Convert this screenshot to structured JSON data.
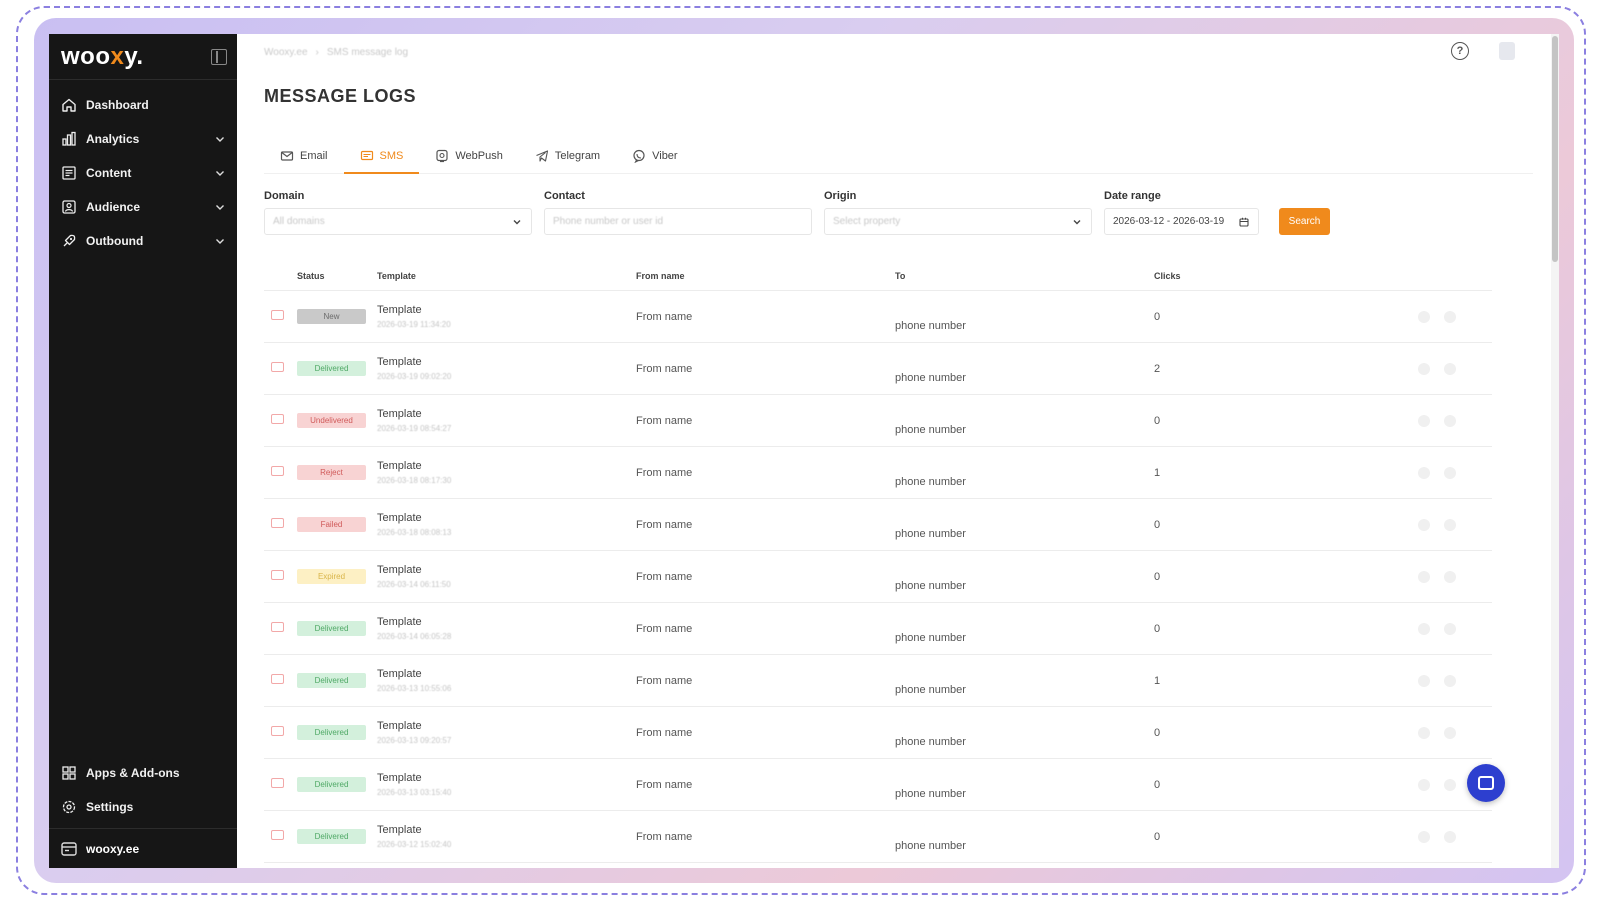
{
  "sidebar": {
    "logo_pre": "woo",
    "logo_x": "x",
    "logo_post": "y.",
    "nav": [
      {
        "label": "Dashboard",
        "icon": "home-icon",
        "expandable": false
      },
      {
        "label": "Analytics",
        "icon": "bar-chart-icon",
        "expandable": true
      },
      {
        "label": "Content",
        "icon": "content-icon",
        "expandable": true
      },
      {
        "label": "Audience",
        "icon": "user-icon",
        "expandable": true
      },
      {
        "label": "Outbound",
        "icon": "rocket-icon",
        "expandable": true
      }
    ],
    "bottom": [
      {
        "label": "Apps & Add-ons",
        "icon": "grid-icon"
      },
      {
        "label": "Settings",
        "icon": "gear-icon"
      }
    ],
    "footer": {
      "label": "wooxy.ee",
      "icon": "site-icon"
    }
  },
  "breadcrumb": [
    "Wooxy.ee",
    "SMS message log"
  ],
  "page": {
    "title": "MESSAGE LOGS"
  },
  "tabs": [
    {
      "label": "Email",
      "icon": "mail-icon",
      "active": false
    },
    {
      "label": "SMS",
      "icon": "sms-icon",
      "active": true
    },
    {
      "label": "WebPush",
      "icon": "webpush-icon",
      "active": false
    },
    {
      "label": "Telegram",
      "icon": "telegram-icon",
      "active": false
    },
    {
      "label": "Viber",
      "icon": "viber-icon",
      "active": false
    }
  ],
  "filters": {
    "domain": {
      "label": "Domain",
      "placeholder": "All domains"
    },
    "contact": {
      "label": "Contact",
      "placeholder": "Phone number or user id"
    },
    "origin": {
      "label": "Origin",
      "placeholder": "Select property"
    },
    "date_range": {
      "label": "Date range",
      "value": "2026-03-12 - 2026-03-19"
    },
    "search_label": "Search"
  },
  "table": {
    "headers": {
      "status": "Status",
      "template": "Template",
      "from": "From name",
      "to": "To",
      "clicks": "Clicks"
    },
    "rows": [
      {
        "status": "New",
        "status_class": "st-new",
        "template": "Template",
        "date": "2026-03-19 11:34:20",
        "from": "From name",
        "to": "phone number",
        "clicks": "0"
      },
      {
        "status": "Delivered",
        "status_class": "st-delivered",
        "template": "Template",
        "date": "2026-03-19 09:02:20",
        "from": "From name",
        "to": "phone number",
        "clicks": "2"
      },
      {
        "status": "Undelivered",
        "status_class": "st-undelivered",
        "template": "Template",
        "date": "2026-03-19 08:54:27",
        "from": "From name",
        "to": "phone number",
        "clicks": "0"
      },
      {
        "status": "Reject",
        "status_class": "st-reject",
        "template": "Template",
        "date": "2026-03-18 08:17:30",
        "from": "From name",
        "to": "phone number",
        "clicks": "1"
      },
      {
        "status": "Failed",
        "status_class": "st-failed",
        "template": "Template",
        "date": "2026-03-18 08:08:13",
        "from": "From name",
        "to": "phone number",
        "clicks": "0"
      },
      {
        "status": "Expired",
        "status_class": "st-expired",
        "template": "Template",
        "date": "2026-03-14 06:11:50",
        "from": "From name",
        "to": "phone number",
        "clicks": "0"
      },
      {
        "status": "Delivered",
        "status_class": "st-delivered",
        "template": "Template",
        "date": "2026-03-14 06:05:28",
        "from": "From name",
        "to": "phone number",
        "clicks": "0"
      },
      {
        "status": "Delivered",
        "status_class": "st-delivered",
        "template": "Template",
        "date": "2026-03-13 10:55:06",
        "from": "From name",
        "to": "phone number",
        "clicks": "1"
      },
      {
        "status": "Delivered",
        "status_class": "st-delivered",
        "template": "Template",
        "date": "2026-03-13 09:20:57",
        "from": "From name",
        "to": "phone number",
        "clicks": "0"
      },
      {
        "status": "Delivered",
        "status_class": "st-delivered",
        "template": "Template",
        "date": "2026-03-13 03:15:40",
        "from": "From name",
        "to": "phone number",
        "clicks": "0"
      },
      {
        "status": "Delivered",
        "status_class": "st-delivered",
        "template": "Template",
        "date": "2026-03-12 15:02:40",
        "from": "From name",
        "to": "phone number",
        "clicks": "0"
      }
    ]
  },
  "colors": {
    "accent": "#f08a1c",
    "sidebar_bg": "#161616",
    "chat": "#2d3fcf"
  }
}
